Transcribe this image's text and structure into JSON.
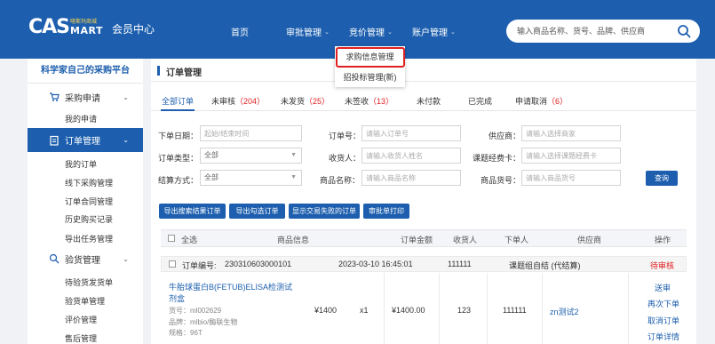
{
  "header": {
    "logo_mark": "CAS",
    "logo_cn": "喀斯玛商城",
    "logo_smart": "MART",
    "member_center": "会员中心",
    "nav": [
      {
        "label": "首页",
        "chevron": ""
      },
      {
        "label": "审批管理",
        "chevron": "⌄"
      },
      {
        "label": "竞价管理",
        "chevron": "⌄"
      },
      {
        "label": "账户管理",
        "chevron": "⌄"
      }
    ],
    "search_placeholder": "输入商品名称、货号、品牌、供应商"
  },
  "dropdown": {
    "items": [
      "求购信息管理",
      "招投标管理(新)"
    ]
  },
  "sidebar": {
    "title": "科学家自己的采购平台",
    "groups": [
      {
        "label": "采购申请",
        "icon": "cart-icon",
        "arrow": "⌄"
      },
      {
        "label": "订单管理",
        "icon": "clipboard-icon",
        "arrow": "⌄"
      },
      {
        "label": "验货管理",
        "icon": "inspect-icon",
        "arrow": "⌄"
      }
    ],
    "purchase_items": [
      "我的申请"
    ],
    "order_items": [
      "我的订单",
      "线下采购管理",
      "订单合同管理",
      "历史购买记录",
      "导出任务管理"
    ],
    "inspect_items": [
      "待验货发货单",
      "验货单管理",
      "评价管理",
      "售后管理"
    ]
  },
  "main": {
    "title": "订单管理",
    "tabs": [
      {
        "label": "全部订单",
        "count": ""
      },
      {
        "label": "未审核",
        "count": "（204）"
      },
      {
        "label": "未发货",
        "count": "（25）"
      },
      {
        "label": "未签收",
        "count": "（13）"
      },
      {
        "label": "未付款",
        "count": ""
      },
      {
        "label": "已完成",
        "count": ""
      },
      {
        "label": "申请取消",
        "count": "（6）"
      }
    ],
    "filters": {
      "order_date_label": "下单日期：",
      "order_date_placeholder": "起始/结束时间",
      "order_no_label": "订单号：",
      "order_no_placeholder": "请输入订单号",
      "supplier_label": "供应商：",
      "supplier_placeholder": "请输入选择商家",
      "order_type_label": "订单类型：",
      "order_type_value": "全部",
      "receiver_label": "收货人：",
      "receiver_placeholder": "请输入收货人姓名",
      "fund_card_label": "课题经费卡：",
      "fund_card_placeholder": "请输入选择课题经费卡",
      "settle_label": "结算方式：",
      "settle_value": "全部",
      "product_name_label": "商品名称：",
      "product_name_placeholder": "请输入商品名称",
      "product_no_label": "商品货号：",
      "product_no_placeholder": "请输入商品货号",
      "query_button": "查询"
    },
    "actions": [
      "导出搜索结果订单",
      "导出勾选订单",
      "显示交易失败的订单",
      "审批单打印"
    ],
    "table_headers": [
      "全选",
      "商品信息",
      "订单金额",
      "收货人",
      "下单人",
      "供应商",
      "操作"
    ],
    "order": {
      "no_label": "订单编号:",
      "no": "230310603000101",
      "datetime": "2023-03-10 16:45:01",
      "orderer": "111111",
      "fund": "课题组自结 (代结算)",
      "status": "待审核",
      "product_name_line1": "牛胎球蛋白B(FETUB)ELISA检测试",
      "product_name_line2": "剂盒",
      "sku": "货号：ml002629",
      "brand": "品牌：mlbio/酶联生物",
      "spec": "规格：96T",
      "price": "¥1400",
      "qty": "x1",
      "amount": "¥1400.00",
      "receiver": "123",
      "buyer": "111111",
      "supplier": "zn测试2",
      "ops": [
        "送审",
        "再次下单",
        "取消订单",
        "订单详情"
      ]
    }
  }
}
